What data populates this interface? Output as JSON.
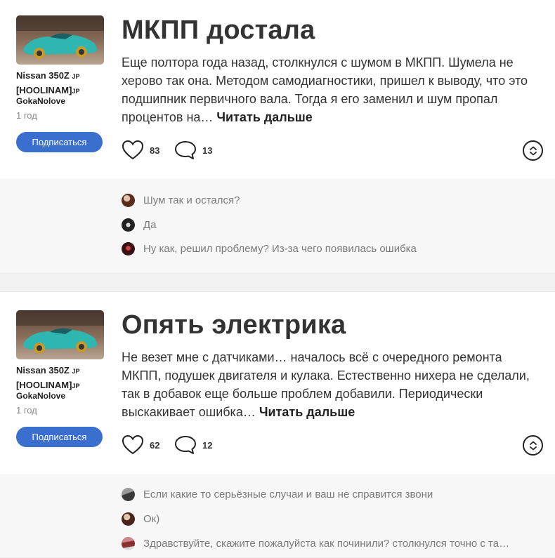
{
  "posts": [
    {
      "car_name": "Nissan 350Z",
      "car_suffix1": "JP",
      "car_line2": "[HOOLINAM]",
      "car_suffix2": "JP",
      "author": "GokaNolove",
      "age": "1 год",
      "subscribe_label": "Подписаться",
      "title": "МКПП достала",
      "excerpt": "Еще полтора года назад, столкнулся с шумом в МКПП. Шумела не херово так она. Методом самодиагностики, пришел к выводу, что это подшипник первичного вала. Тогда я его заменил и шум пропал процентов на… ",
      "read_more": "Читать дальше",
      "likes": "83",
      "comments_count": "13",
      "comments": [
        {
          "text": "Шум так и остался?",
          "avatar_color": "#5a2a1a"
        },
        {
          "text": "Да",
          "avatar_color": "#222222"
        },
        {
          "text": "Ну как, решил проблему? Из-за чего появилась ошибка",
          "avatar_color": "#7a1e1e"
        }
      ]
    },
    {
      "car_name": "Nissan 350Z",
      "car_suffix1": "JP",
      "car_line2": "[HOOLINAM]",
      "car_suffix2": "JP",
      "author": "GokaNolove",
      "age": "1 год",
      "subscribe_label": "Подписаться",
      "title": "Опять электрика",
      "excerpt": "Не везет мне с датчиками… началось всё с очередного ремонта МКПП, подушек двигателя и кулака. Естественно нихера не сделали, так в добавок еще больше проблем добавили. Периодически выскакивает ошибка… ",
      "read_more": "Читать дальше",
      "likes": "62",
      "comments_count": "12",
      "comments": [
        {
          "text": "Если какие то серьёзные случаи и ваш не справится звони",
          "avatar_color": "#6b6b6b"
        },
        {
          "text": "Ок)",
          "avatar_color": "#4a2418"
        },
        {
          "text": "Здравствуйте, скажите пожалуйста как починили? столкнулся точно с та…",
          "avatar_color": "#8a3030"
        }
      ]
    }
  ],
  "colors": {
    "accent": "#3a6fd0",
    "car_teal": "#2fb6b0",
    "comment_text": "#7a7a7a"
  }
}
